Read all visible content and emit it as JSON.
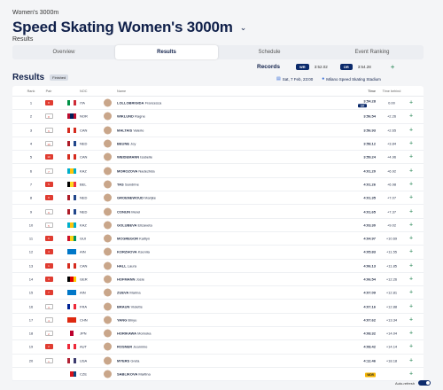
{
  "breadcrumb": "Women's 3000m",
  "title": "Speed Skating Women's 3000m",
  "subtitle": "Results",
  "tabs": [
    "Overview",
    "Results",
    "Schedule",
    "Event Ranking"
  ],
  "records": {
    "label": "Records",
    "wr_badge": "WR",
    "wr_time": "3:52.02",
    "or_badge": "OR",
    "or_time": "3:54.28"
  },
  "results": {
    "title": "Results",
    "status": "Finished",
    "date": "Sat, 7 Feb, 23:00",
    "venue": "Milano Speed Skating Stadium"
  },
  "columns": {
    "rank": "Rank",
    "pair": "Pair",
    "noc": "NOC",
    "name": "Name",
    "time": "Time",
    "behind": "Time behind"
  },
  "rows": [
    {
      "rank": "1",
      "pair": "8",
      "lane": "red",
      "noc": "ITA",
      "flag": [
        "#009246",
        "#ffffff",
        "#ce2b37"
      ],
      "surname": "LOLLOBRIGIDA",
      "first": "Francesca",
      "time": "3:54.28",
      "or": "OR",
      "behind": "0.00"
    },
    {
      "rank": "2",
      "pair": "8",
      "lane": "white",
      "noc": "NOR",
      "flag": [
        "#ba0c2f",
        "#00205b",
        "#ba0c2f"
      ],
      "surname": "WIKLUND",
      "first": "Ragne",
      "time": "3:56.54",
      "behind": "+2.26"
    },
    {
      "rank": "3",
      "pair": "6",
      "lane": "white",
      "noc": "CAN",
      "flag": [
        "#d52b1e",
        "#ffffff",
        "#d52b1e"
      ],
      "surname": "MALTAIS",
      "first": "Valerie",
      "time": "3:56.93",
      "behind": "+2.65"
    },
    {
      "rank": "4",
      "pair": "10",
      "lane": "white",
      "noc": "NED",
      "flag": [
        "#ae1c28",
        "#ffffff",
        "#21468b"
      ],
      "surname": "BEUNE",
      "first": "Joy",
      "time": "3:58.12",
      "behind": "+3.84"
    },
    {
      "rank": "5",
      "pair": "10",
      "lane": "red",
      "noc": "CAN",
      "flag": [
        "#d52b1e",
        "#ffffff",
        "#d52b1e"
      ],
      "surname": "WEIDEMANN",
      "first": "Isabelle",
      "time": "3:59.24",
      "behind": "+4.96"
    },
    {
      "rank": "6",
      "pair": "7",
      "lane": "white",
      "noc": "KAZ",
      "flag": [
        "#00afca",
        "#fec50c",
        "#00afca"
      ],
      "surname": "MOROZOVA",
      "first": "Nadezhda",
      "time": "4:01.20",
      "behind": "+6.92"
    },
    {
      "rank": "7",
      "pair": "5",
      "lane": "red",
      "noc": "BEL",
      "flag": [
        "#000000",
        "#fdda24",
        "#ef3340"
      ],
      "surname": "TAS",
      "first": "Sandrine",
      "time": "4:01.26",
      "behind": "+6.98"
    },
    {
      "rank": "8",
      "pair": "9",
      "lane": "red",
      "noc": "NED",
      "flag": [
        "#ae1c28",
        "#ffffff",
        "#21468b"
      ],
      "surname": "GROENEWOUD",
      "first": "Marijke",
      "time": "4:01.35",
      "behind": "+7.07"
    },
    {
      "rank": "9",
      "pair": "9",
      "lane": "white",
      "noc": "NED",
      "flag": [
        "#ae1c28",
        "#ffffff",
        "#21468b"
      ],
      "surname": "CONIJN",
      "first": "Merel",
      "time": "4:01.65",
      "behind": "+7.37"
    },
    {
      "rank": "10",
      "pair": "5",
      "lane": "white",
      "noc": "KAZ",
      "flag": [
        "#00afca",
        "#fec50c",
        "#00afca"
      ],
      "surname": "GOLUBEVA",
      "first": "Elizaveta",
      "time": "4:03.30",
      "behind": "+9.02"
    },
    {
      "rank": "11",
      "pair": "6",
      "lane": "red",
      "noc": "GUI",
      "flag": [
        "#ce1126",
        "#fcd116",
        "#009460"
      ],
      "surname": "MCGREGOR",
      "first": "Kaitlyn",
      "time": "4:04.97",
      "behind": "+10.69"
    },
    {
      "rank": "12",
      "pair": "4",
      "lane": "red",
      "noc": "AIN",
      "flag": [
        "#0077c8",
        "#0077c8",
        "#0077c8"
      ],
      "surname": "KORZHOVA",
      "first": "Kseniia",
      "time": "4:05.83",
      "behind": "+11.55"
    },
    {
      "rank": "13",
      "pair": "1",
      "lane": "red",
      "noc": "CAN",
      "flag": [
        "#d52b1e",
        "#ffffff",
        "#d52b1e"
      ],
      "surname": "HALL",
      "first": "Laura",
      "time": "4:06.13",
      "behind": "+11.85"
    },
    {
      "rank": "14",
      "pair": "3",
      "lane": "red",
      "noc": "GER",
      "flag": [
        "#000000",
        "#dd0000",
        "#ffce00"
      ],
      "surname": "HOFMANN",
      "first": "Josie",
      "time": "4:06.54",
      "behind": "+12.26"
    },
    {
      "rank": "15",
      "pair": "7",
      "lane": "red",
      "noc": "AIN",
      "flag": [
        "#0077c8",
        "#0077c8",
        "#0077c8"
      ],
      "surname": "ZUEVA",
      "first": "Marina",
      "time": "4:07.09",
      "behind": "+12.81"
    },
    {
      "rank": "16",
      "pair": "3",
      "lane": "white",
      "noc": "FRA",
      "flag": [
        "#002395",
        "#ffffff",
        "#ed2939"
      ],
      "surname": "BRAUN",
      "first": "Violette",
      "time": "4:07.16",
      "behind": "+12.88"
    },
    {
      "rank": "17",
      "pair": "4",
      "lane": "white",
      "noc": "CHN",
      "flag": [
        "#de2910",
        "#de2910",
        "#de2910"
      ],
      "surname": "YANG",
      "first": "Binyu",
      "time": "4:07.62",
      "behind": "+13.34"
    },
    {
      "rank": "18",
      "pair": "2",
      "lane": "white",
      "noc": "JPN",
      "flag": [
        "#ffffff",
        "#bc002d",
        "#ffffff"
      ],
      "surname": "HORIKAWA",
      "first": "Momoka",
      "time": "4:08.32",
      "behind": "+14.04"
    },
    {
      "rank": "19",
      "pair": "2",
      "lane": "red",
      "noc": "AUT",
      "flag": [
        "#ed2939",
        "#ffffff",
        "#ed2939"
      ],
      "surname": "ROSNER",
      "first": "Jeannine",
      "time": "4:08.42",
      "behind": "+14.14"
    },
    {
      "rank": "20",
      "pair": "1",
      "lane": "white",
      "noc": "USA",
      "flag": [
        "#b22234",
        "#ffffff",
        "#3c3b6e"
      ],
      "surname": "MYERS",
      "first": "Greta",
      "time": "4:12.46",
      "behind": "+18.18"
    },
    {
      "rank": "",
      "pair": "",
      "lane": "",
      "noc": "CZE",
      "flag": [
        "#ffffff",
        "#d7141a",
        "#11457e"
      ],
      "surname": "SABLIKOVA",
      "first": "Martina",
      "time": "",
      "wdr": "WDR",
      "behind": ""
    }
  ],
  "auto_refresh": "Auto-refresh"
}
